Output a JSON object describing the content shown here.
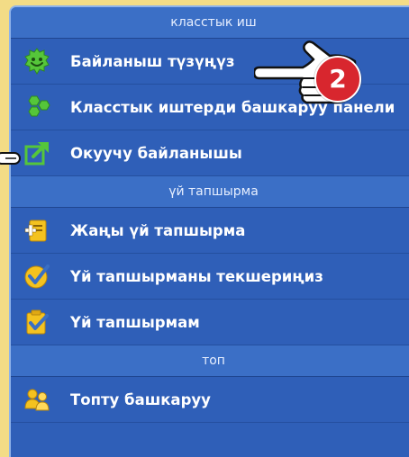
{
  "sections": [
    {
      "header": "класстык иш",
      "items": [
        {
          "label": "Байланыш түзүңүз",
          "icon": "green-smiley-icon"
        },
        {
          "label": "Класстык иштерди башкаруу панели",
          "icon": "green-hexagons-icon"
        },
        {
          "label": "Окуучу байланышы",
          "icon": "share-arrow-icon"
        }
      ]
    },
    {
      "header": "үй тапшырма",
      "items": [
        {
          "label": "Жаңы үй тапшырма",
          "icon": "add-document-icon"
        },
        {
          "label": "Үй тапшырманы текшериңиз",
          "icon": "checkmark-badge-icon"
        },
        {
          "label": "Үй тапшырмам",
          "icon": "checklist-icon"
        }
      ]
    },
    {
      "header": "топ",
      "items": [
        {
          "label": "Топту башкаруу",
          "icon": "group-people-icon"
        }
      ]
    }
  ],
  "callout": {
    "step_number": "2"
  },
  "colors": {
    "page_bg": "#f3dc86",
    "panel_bg": "#2f5fb8",
    "header_bg": "#3b6fc6",
    "badge_red": "#d8262e",
    "icon_green": "#55c63a",
    "icon_yellow": "#f4c21f"
  }
}
